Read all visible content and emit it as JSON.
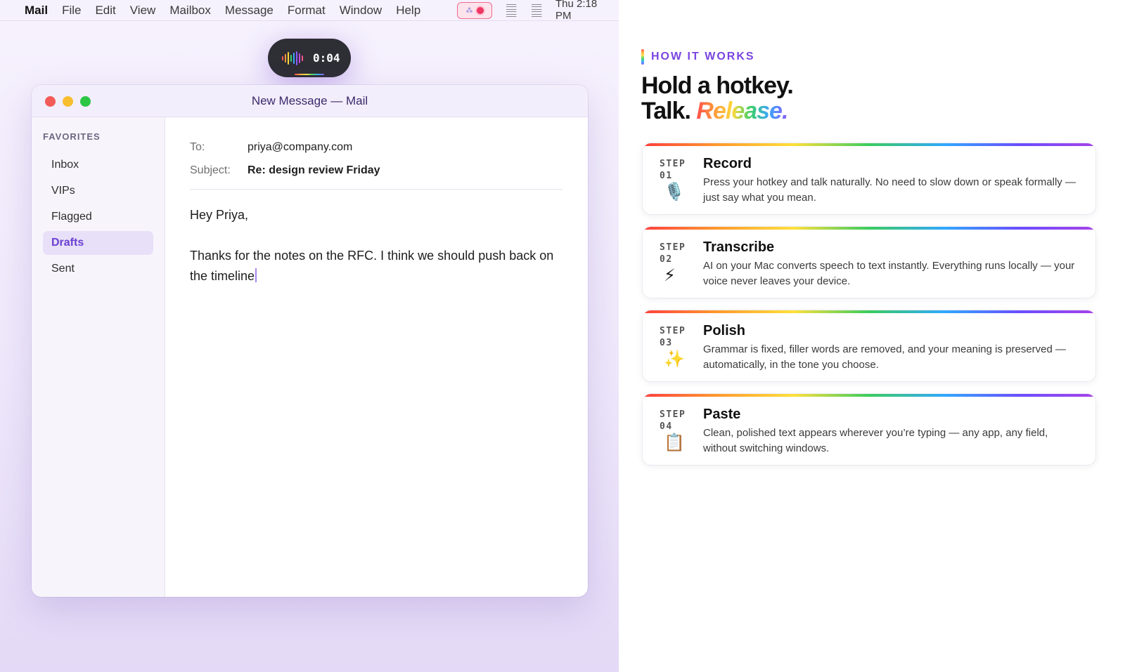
{
  "menubar": {
    "app": "Mail",
    "items": [
      "File",
      "Edit",
      "View",
      "Mailbox",
      "Message",
      "Format",
      "Window",
      "Help"
    ],
    "clock": "Thu 2:18 PM"
  },
  "recorder": {
    "time": "0:04"
  },
  "mail": {
    "window_title": "New Message — Mail",
    "sidebar": {
      "header": "FAVORITES",
      "items": [
        {
          "label": "Inbox"
        },
        {
          "label": "VIPs"
        },
        {
          "label": "Flagged"
        },
        {
          "label": "Drafts"
        },
        {
          "label": "Sent"
        }
      ],
      "active": "Drafts"
    },
    "compose": {
      "to_label": "To:",
      "to": "priya@company.com",
      "subject_label": "Subject:",
      "subject": "Re: design review Friday",
      "body_lines": [
        "Hey Priya,",
        "",
        "Thanks for the notes on the RFC. I think we should push back on the timeline"
      ]
    }
  },
  "panel": {
    "eyebrow": "HOW IT WORKS",
    "headline_line1": "Hold a hotkey.",
    "headline_talk": "Talk.",
    "headline_release": "Release.",
    "steps": [
      {
        "step_label": "STEP",
        "num": "01",
        "icon": "microphone-icon",
        "glyph": "🎙️",
        "title": "Record",
        "desc": "Press your hotkey and talk naturally. No need to slow down or speak formally — just say what you mean."
      },
      {
        "step_label": "STEP",
        "num": "02",
        "icon": "lightning-icon",
        "glyph": "⚡",
        "title": "Transcribe",
        "desc": "AI on your Mac converts speech to text instantly. Everything runs locally — your voice never leaves your device."
      },
      {
        "step_label": "STEP",
        "num": "03",
        "icon": "sparkles-icon",
        "glyph": "✨",
        "title": "Polish",
        "desc": "Grammar is fixed, filler words are removed, and your meaning is preserved — automatically, in the tone you choose."
      },
      {
        "step_label": "STEP",
        "num": "04",
        "icon": "clipboard-icon",
        "glyph": "📋",
        "title": "Paste",
        "desc": "Clean, polished text appears wherever you’re typing — any app, any field, without switching windows."
      }
    ]
  },
  "colors": {
    "accent": "#7a45e0",
    "sidebar_active_bg": "#e8e0f8",
    "record_dot": "#ef3561"
  }
}
